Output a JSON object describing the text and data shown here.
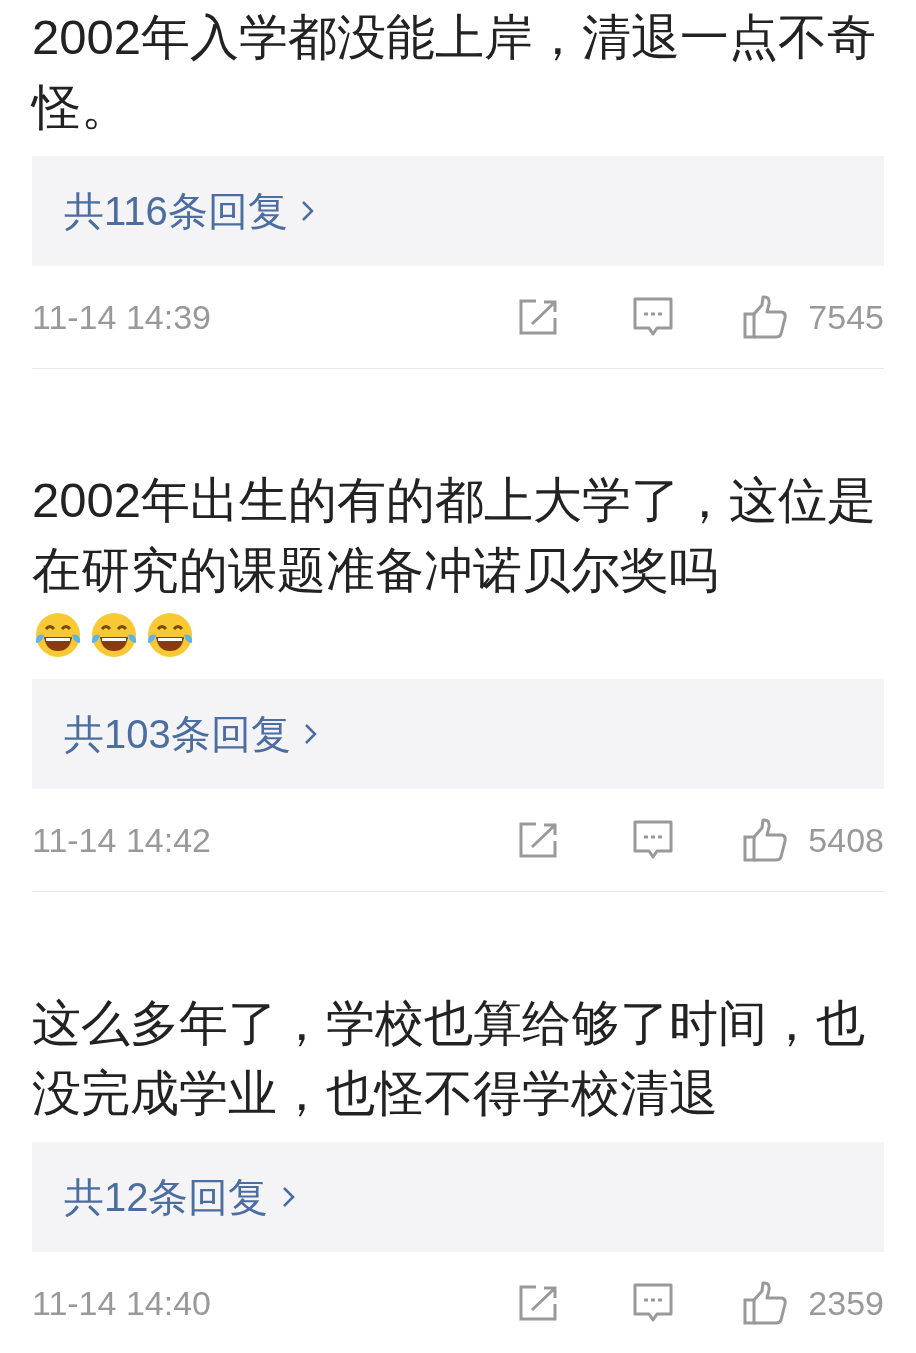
{
  "comments": [
    {
      "text": "2002年入学都没能上岸，清退一点不奇怪。",
      "replies": "共116条回复",
      "time": "11-14 14:39",
      "likes": "7545"
    },
    {
      "text": "2002年出生的有的都上大学了，这位是在研究的课题准备冲诺贝尔奖吗",
      "emojis": [
        {
          "kind": "laughing"
        },
        {
          "kind": "laughing"
        },
        {
          "kind": "laughing"
        }
      ],
      "replies": "共103条回复",
      "time": "11-14 14:42",
      "likes": "5408"
    },
    {
      "text": "这么多年了，学校也算给够了时间，也没完成学业，也怪不得学校清退",
      "replies": "共12条回复",
      "time": "11-14 14:40",
      "likes": "2359"
    }
  ]
}
